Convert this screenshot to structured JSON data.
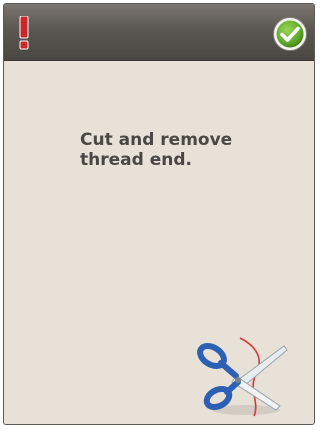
{
  "dialog": {
    "header": {
      "warning_icon": "exclamation-icon",
      "confirm_icon": "checkmark-icon",
      "colors": {
        "header_bg": "#5b5752",
        "warning": "#c8282a",
        "confirm": "#5ea82a"
      }
    },
    "message": "Cut and remove\nthread end.",
    "illustration": {
      "icon": "scissors-icon",
      "colors": {
        "handle": "#2d5fb3",
        "thread": "#d33a3a"
      }
    },
    "background_color": "#e7e1d8"
  }
}
